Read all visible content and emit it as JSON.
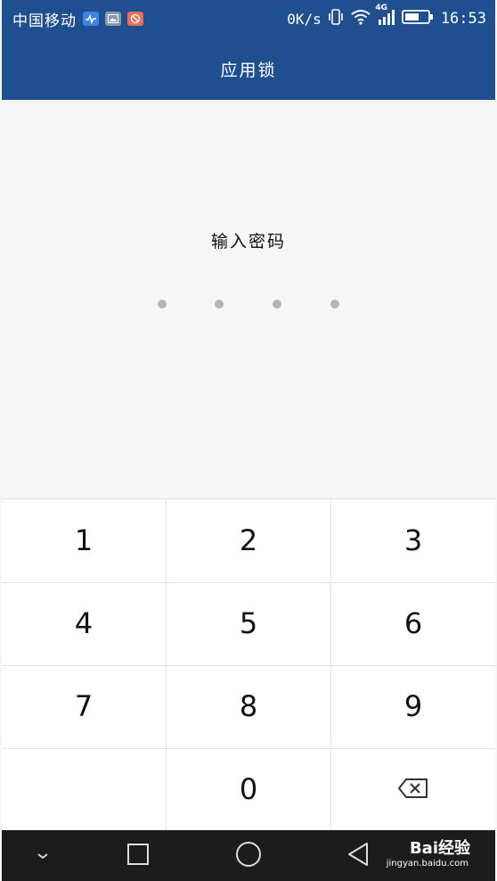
{
  "status_bar": {
    "carrier": "中国移动",
    "net_speed": "0K/s",
    "network_type": "4G",
    "time": "16:53",
    "icons": [
      "health-app-icon",
      "gallery-app-icon",
      "blocked-app-icon",
      "vibrate-icon",
      "wifi-icon",
      "signal-icon",
      "battery-icon"
    ]
  },
  "header": {
    "title": "应用锁"
  },
  "password": {
    "prompt": "输入密码",
    "length": 4,
    "entered": 0
  },
  "keypad": {
    "keys": [
      "1",
      "2",
      "3",
      "4",
      "5",
      "6",
      "7",
      "8",
      "9",
      "",
      "0"
    ],
    "backspace_icon": "backspace-icon"
  },
  "nav_bar": {
    "buttons": [
      "chevron-down-icon",
      "recents-icon",
      "home-icon",
      "back-icon"
    ]
  },
  "watermark": {
    "brand": "Bai经验",
    "url": "jingyan.baidu.com"
  },
  "colors": {
    "header_bg": "#1f4f8f",
    "nav_bg": "#1c1c1c",
    "dot": "#b5b5b5"
  }
}
